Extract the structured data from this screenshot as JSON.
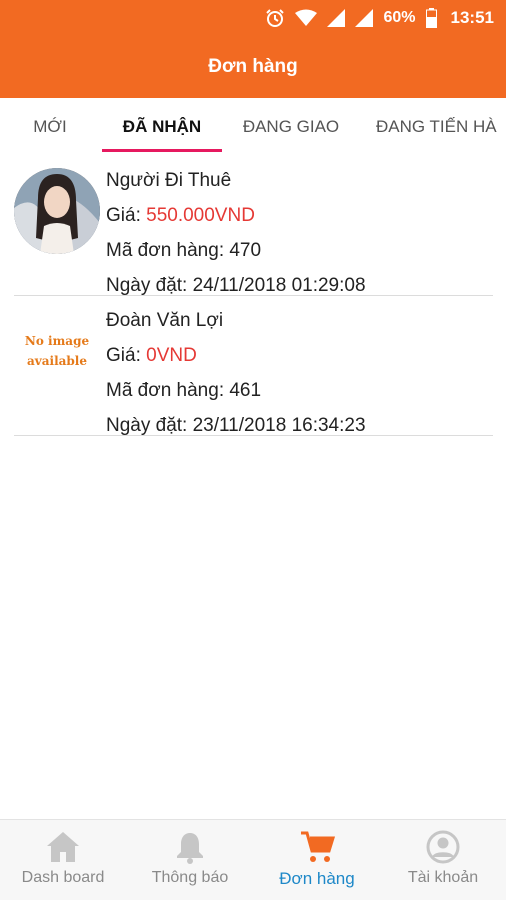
{
  "statusbar": {
    "battery_percent": "60%",
    "time": "13:51",
    "icons": [
      "alarm-icon",
      "wifi-icon",
      "signal-icon",
      "signal-icon",
      "battery-icon"
    ]
  },
  "appbar": {
    "title": "Đơn hàng"
  },
  "tabs": {
    "items": [
      {
        "label": "MỚI"
      },
      {
        "label": "ĐÃ NHẬN",
        "active": true
      },
      {
        "label": "ĐANG GIAO"
      },
      {
        "label": "ĐANG TIẾN HÀ"
      }
    ],
    "indicator_color": "#e6195f"
  },
  "orders": [
    {
      "name": "Người Đi Thuê",
      "price_label": "Giá: ",
      "price": "550.000VND",
      "code": "Mã đơn hàng: 470",
      "date": "Ngày đặt: 24/11/2018 01:29:08",
      "image": "avatar-photo"
    },
    {
      "name": "Đoàn Văn Lợi",
      "price_label": "Giá: ",
      "price": "0VND",
      "code": "Mã đơn hàng: 461",
      "date": "Ngày đặt: 23/11/2018 16:34:23",
      "placeholder_line1": "No image",
      "placeholder_line2": "available"
    }
  ],
  "bottomnav": {
    "items": [
      {
        "label": "Dash board",
        "icon": "home-icon"
      },
      {
        "label": "Thông báo",
        "icon": "bell-icon"
      },
      {
        "label": "Đơn hàng",
        "icon": "cart-icon",
        "active": true
      },
      {
        "label": "Tài khoản",
        "icon": "account-icon"
      }
    ]
  },
  "colors": {
    "primary": "#f26a22",
    "price": "#e53935",
    "active_nav": "#1e88c8",
    "inactive_icon": "#c6c6c6"
  }
}
